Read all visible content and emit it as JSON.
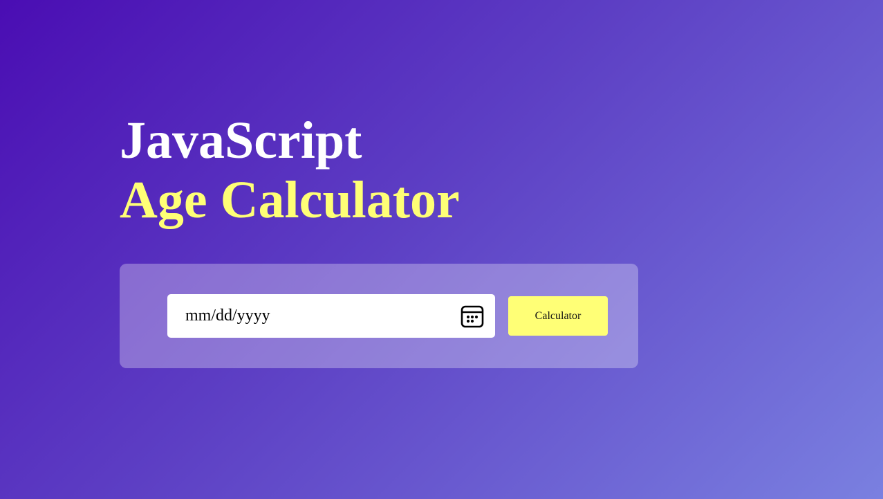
{
  "heading": {
    "line1": "JavaScript",
    "line2": "Age Calculator"
  },
  "form": {
    "date_placeholder": "mm/dd/yyyy",
    "button_label": "Calculator",
    "calendar_icon": "calendar-icon"
  },
  "colors": {
    "accent_yellow": "#ffff76",
    "background_start": "#4a0db3",
    "background_end": "#7a80e0",
    "title_white": "#ffffff"
  }
}
